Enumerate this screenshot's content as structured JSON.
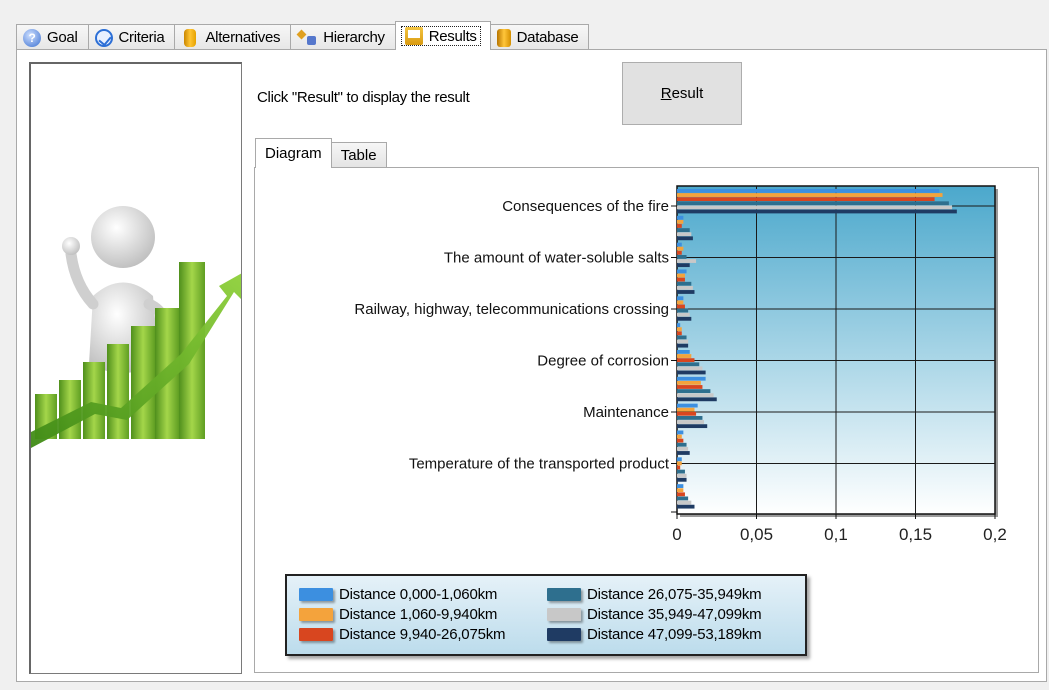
{
  "tabs": [
    {
      "label": "Goal",
      "icon": "help-icon"
    },
    {
      "label": "Criteria",
      "icon": "check-circle-icon"
    },
    {
      "label": "Alternatives",
      "icon": "cylinder-icon"
    },
    {
      "label": "Hierarchy",
      "icon": "hierarchy-icon"
    },
    {
      "label": "Results",
      "icon": "results-folder-icon",
      "active": true
    },
    {
      "label": "Database",
      "icon": "database-icon"
    }
  ],
  "main": {
    "prompt": "Click \"Result\" to display the result",
    "result_button": {
      "underlined": "R",
      "rest": "esult"
    },
    "view_tabs": [
      {
        "label": "Diagram",
        "active": true
      },
      {
        "label": "Table",
        "active": false
      }
    ]
  },
  "colors": {
    "plot_bg_top": "#4ba8cc",
    "plot_bg_bottom": "#ffffff",
    "series": [
      "#3c8fe0",
      "#f4a33c",
      "#d8461f",
      "#2e6f8e",
      "#c8c8c8",
      "#1f3b63"
    ]
  },
  "chart_data": {
    "type": "bar",
    "orientation": "horizontal",
    "categories": [
      "Consequences of the fire",
      "The amount of water-soluble salts",
      "Railway, highway, telecommunications crossing",
      "Degree of corrosion",
      "Maintenance",
      "Temperature of the transported product"
    ],
    "xlim": [
      0,
      0.2
    ],
    "x_ticks": [
      "0",
      "0,05",
      "0,1",
      "0,15",
      "0,2"
    ],
    "grid": true,
    "legend_position": "bottom-left",
    "groups": 12,
    "series": [
      {
        "name": "Distance 0,000-1,060km",
        "values": [
          0.165,
          0.004,
          0.003,
          0.006,
          0.004,
          0.002,
          0.008,
          0.018,
          0.013,
          0.004,
          0.003,
          0.004
        ]
      },
      {
        "name": "Distance 1,060-9,940km",
        "values": [
          0.167,
          0.004,
          0.004,
          0.005,
          0.004,
          0.003,
          0.009,
          0.015,
          0.011,
          0.003,
          0.003,
          0.004
        ]
      },
      {
        "name": "Distance 9,940-26,075km",
        "values": [
          0.162,
          0.003,
          0.003,
          0.005,
          0.005,
          0.003,
          0.011,
          0.016,
          0.012,
          0.004,
          0.002,
          0.005
        ]
      },
      {
        "name": "Distance 26,075-35,949km",
        "values": [
          0.171,
          0.008,
          0.006,
          0.009,
          0.007,
          0.006,
          0.014,
          0.021,
          0.016,
          0.006,
          0.005,
          0.007
        ]
      },
      {
        "name": "Distance 35,949-47,099km",
        "values": [
          0.173,
          0.009,
          0.012,
          0.01,
          0.008,
          0.007,
          0.016,
          0.023,
          0.017,
          0.007,
          0.006,
          0.009
        ]
      },
      {
        "name": "Distance 47,099-53,189km",
        "values": [
          0.176,
          0.01,
          0.008,
          0.011,
          0.009,
          0.007,
          0.018,
          0.025,
          0.019,
          0.008,
          0.006,
          0.011
        ]
      }
    ]
  }
}
